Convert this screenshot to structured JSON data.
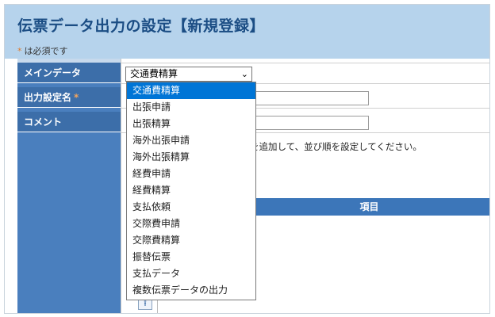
{
  "page": {
    "title": "伝票データ出力の設定【新規登録】",
    "required_note_star": "*",
    "required_note_text": "は必須です"
  },
  "form": {
    "main_data_label": "メインデータ",
    "output_name_label": "出力設定名",
    "output_name_required": "*",
    "comment_label": "コメント",
    "main_data_selected": "交通費精算",
    "description_fragment": "を追加して、並び順を設定してください。",
    "items_header": "項目"
  },
  "dropdown": {
    "options": [
      "交通費精算",
      "出張申請",
      "出張精算",
      "海外出張申請",
      "海外出張精算",
      "経費申請",
      "経費精算",
      "支払依頼",
      "交際費申請",
      "交際費精算",
      "振替伝票",
      "支払データ",
      "複数伝票データの出力"
    ],
    "selected": "交通費精算"
  },
  "icons": {
    "select_arrow": "chevron-down-icon",
    "move_top": "move-to-top-icon"
  },
  "colors": {
    "header_bg": "#b6d3ec",
    "title_text": "#1b4d84",
    "label_bg": "#3c6ea9",
    "required_star": "#e07a2b",
    "selected_option_bg": "#0075d6",
    "items_header_bg": "#3c76b9"
  }
}
